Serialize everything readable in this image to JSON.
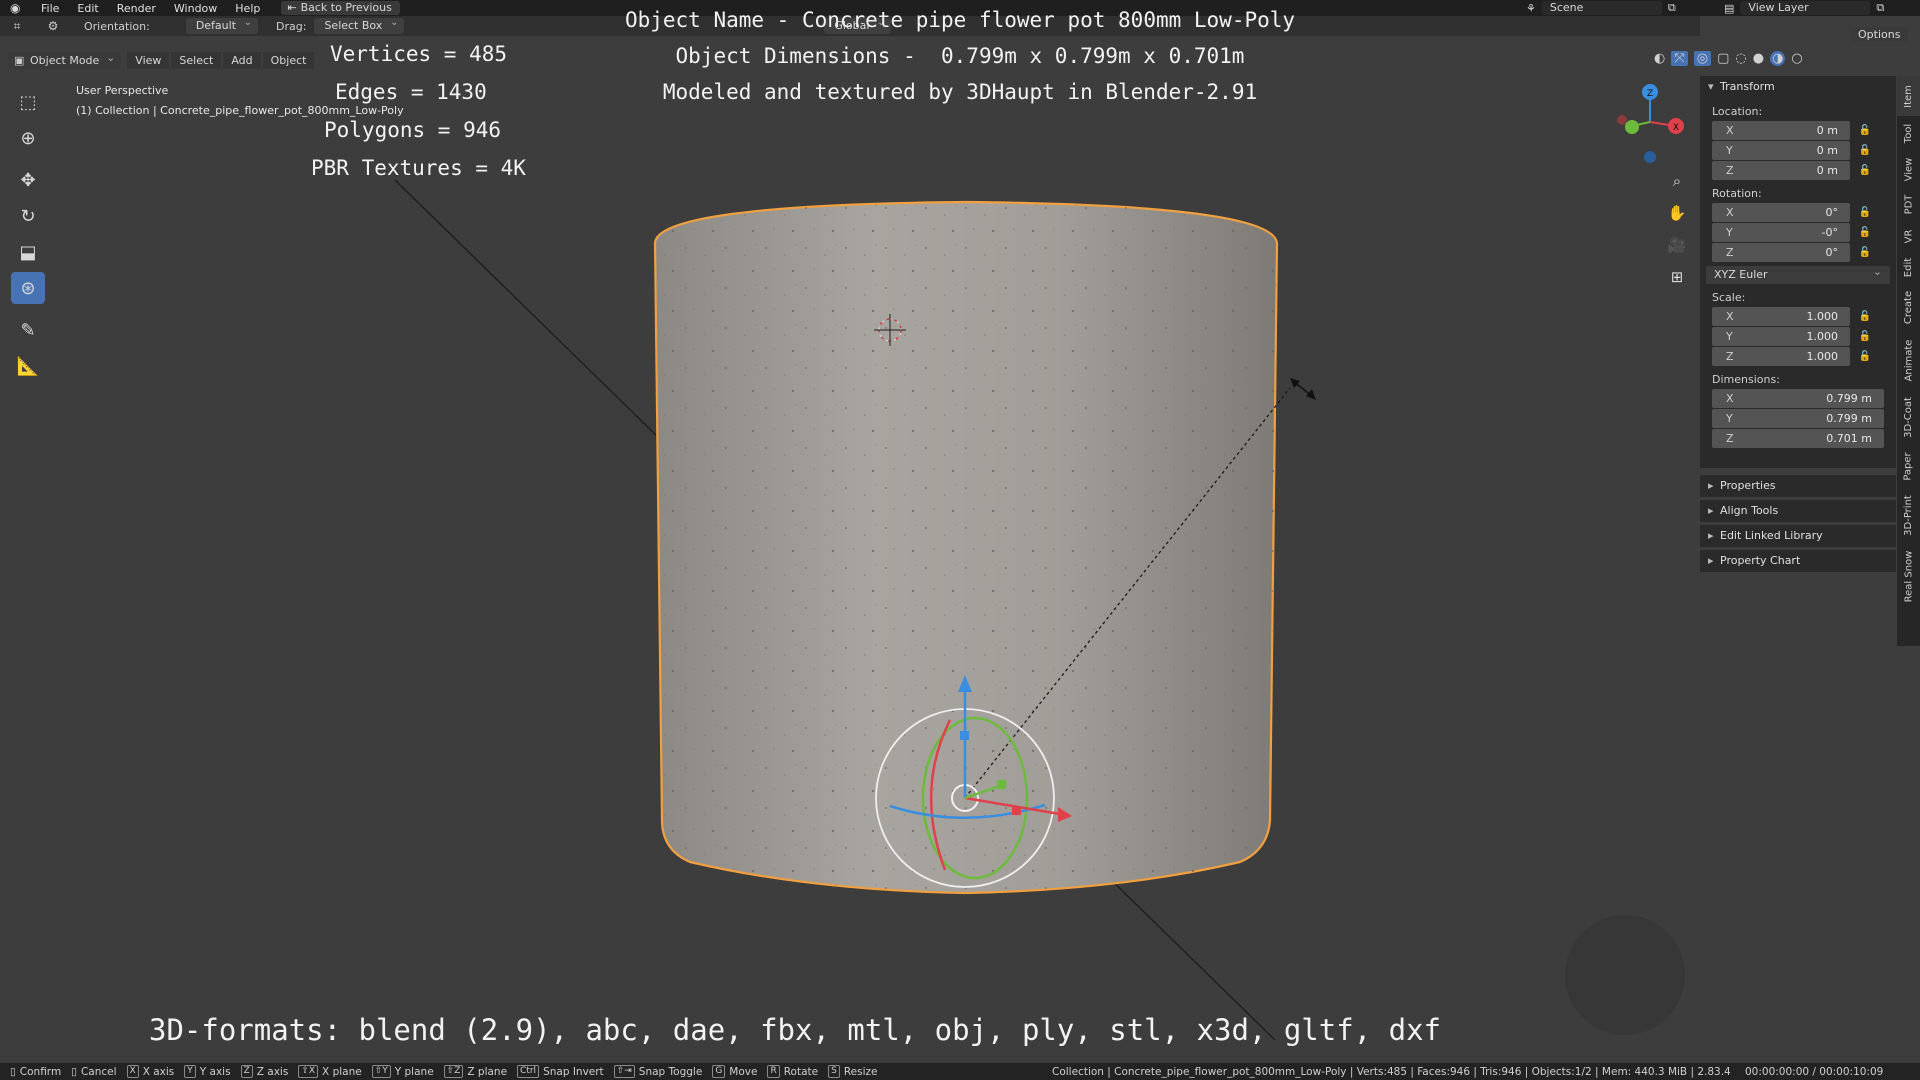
{
  "menubar": {
    "items": [
      "File",
      "Edit",
      "Render",
      "Window",
      "Help"
    ],
    "back_button": "Back to Previous",
    "scene": "Scene",
    "view_layer": "View Layer"
  },
  "header": {
    "orientation_label": "Orientation:",
    "orientation_value": "Default",
    "drag_label": "Drag:",
    "drag_value": "Select Box",
    "transform_orientation": "Global",
    "options": "Options"
  },
  "modebar": {
    "mode": "Object Mode",
    "items": [
      "View",
      "Select",
      "Add",
      "Object"
    ]
  },
  "viewport": {
    "perspective": "User Perspective",
    "collection": "(1) Collection | Concrete_pipe_flower_pot_800mm_Low-Poly",
    "stats": [
      "Vertices = 485",
      "Edges = 1430",
      "Polygons = 946",
      "PBR Textures = 4K"
    ],
    "object_name": "Object Name - Concrete pipe flower pot 800mm Low-Poly",
    "object_dimensions": "Object Dimensions -  0.799m x 0.799m x 0.701m",
    "credit": "Modeled and textured by 3DHaupt in Blender-2.91",
    "formats": "3D-formats: blend (2.9), abc, dae, fbx, mtl, obj, ply, stl, x3d, gltf, dxf",
    "gizmo_axes": {
      "x": "X",
      "y": "Y",
      "z": "Z"
    }
  },
  "npanel": {
    "section": "Transform",
    "location_label": "Location:",
    "location": [
      {
        "axis": "X",
        "value": "0 m"
      },
      {
        "axis": "Y",
        "value": "0 m"
      },
      {
        "axis": "Z",
        "value": "0 m"
      }
    ],
    "rotation_label": "Rotation:",
    "rotation": [
      {
        "axis": "X",
        "value": "0°"
      },
      {
        "axis": "Y",
        "value": "-0°"
      },
      {
        "axis": "Z",
        "value": "0°"
      }
    ],
    "rotation_mode": "XYZ Euler",
    "scale_label": "Scale:",
    "scale": [
      {
        "axis": "X",
        "value": "1.000"
      },
      {
        "axis": "Y",
        "value": "1.000"
      },
      {
        "axis": "Z",
        "value": "1.000"
      }
    ],
    "dimensions_label": "Dimensions:",
    "dimensions": [
      {
        "axis": "X",
        "value": "0.799 m"
      },
      {
        "axis": "Y",
        "value": "0.799 m"
      },
      {
        "axis": "Z",
        "value": "0.701 m"
      }
    ],
    "collapsed": [
      "Properties",
      "Align Tools",
      "Edit Linked Library",
      "Property Chart"
    ]
  },
  "vtabs": [
    "Item",
    "Tool",
    "View",
    "PDT",
    "VR",
    "Edit",
    "Create",
    "Animate",
    "3D-Coat",
    "Paper",
    "3D-Print",
    "Real Snow"
  ],
  "statusbar": {
    "keys": [
      {
        "key": "",
        "label": "Confirm"
      },
      {
        "key": "",
        "label": "Cancel"
      },
      {
        "key": "X",
        "label": "X axis"
      },
      {
        "key": "Y",
        "label": "Y axis"
      },
      {
        "key": "Z",
        "label": "Z axis"
      },
      {
        "key": "⇧X",
        "label": "X plane"
      },
      {
        "key": "⇧Y",
        "label": "Y plane"
      },
      {
        "key": "⇧Z",
        "label": "Z plane"
      },
      {
        "key": "Ctrl",
        "label": "Snap Invert"
      },
      {
        "key": "⇧⇥",
        "label": "Snap Toggle"
      },
      {
        "key": "G",
        "label": "Move"
      },
      {
        "key": "R",
        "label": "Rotate"
      },
      {
        "key": "S",
        "label": "Resize"
      }
    ],
    "info": "Collection | Concrete_pipe_flower_pot_800mm_Low-Poly | Verts:485 | Faces:946 | Tris:946 | Objects:1/2 | Mem: 440.3 MiB | 2.83.4",
    "time": "00:00:00:00 / 00:00:10:09"
  },
  "colors": {
    "selection_outline": "#f0a040",
    "active_tool": "#4772b3",
    "axis_x": "#e0404a",
    "axis_y": "#6cbb3c",
    "axis_z": "#3a8ee0"
  },
  "icons": {
    "navigation": [
      "zoom-icon",
      "pan-hand-icon",
      "camera-icon",
      "grid-icon"
    ]
  }
}
